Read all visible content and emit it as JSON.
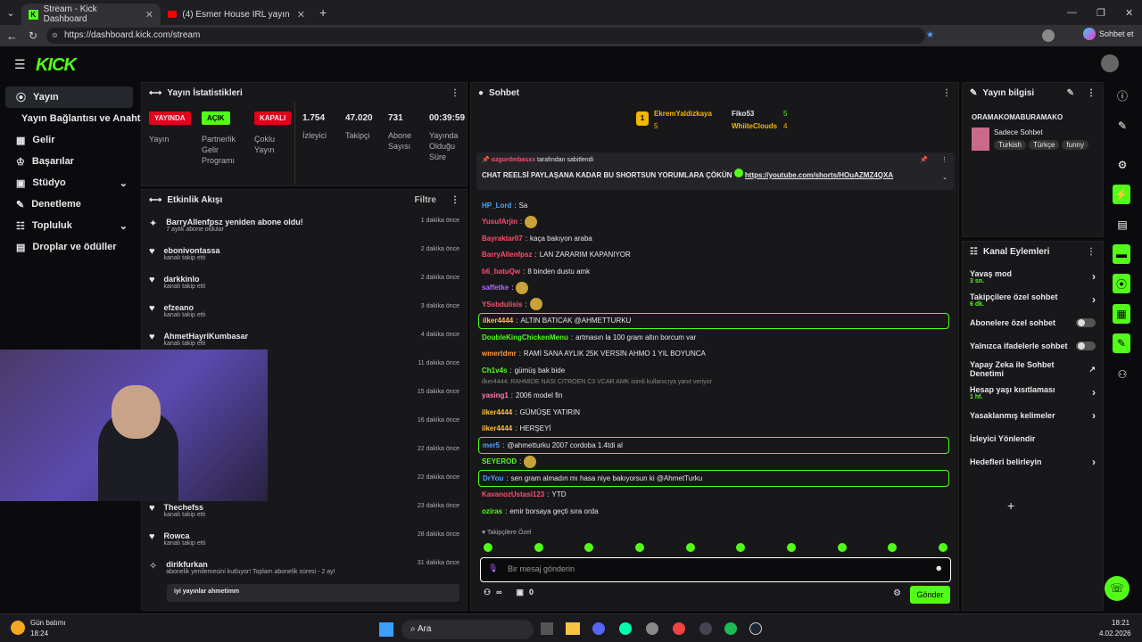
{
  "browser": {
    "tab1": "Stream - Kick Dashboard",
    "tab2": "(4) Esmer House IRL yayın derleme",
    "url": "https://dashboard.kick.com/stream",
    "profile": "Sohbet et"
  },
  "brand": {
    "logo": "KICK",
    "accent": "#53fc18"
  },
  "sidebar": {
    "items": [
      {
        "label": "Yayın"
      },
      {
        "label": "Yayın Bağlantısı ve Anahtarı"
      },
      {
        "label": "Gelir"
      },
      {
        "label": "Başarılar"
      },
      {
        "label": "Stüdyo"
      },
      {
        "label": "Denetleme"
      },
      {
        "label": "Topluluk"
      },
      {
        "label": "Droplar ve ödüller"
      }
    ]
  },
  "stats": {
    "title": "Yayın İstatistikleri",
    "live_badge": "YAYINDA",
    "live_label": "Yayın",
    "partner_badge": "AÇIK",
    "partner_label": "Partnerlik Gelir Programı",
    "multi_badge": "KAPALI",
    "multi_label": "Çoklu Yayın",
    "viewers": "1.754",
    "viewers_label": "İzleyici",
    "followers": "47.020",
    "followers_label": "Takipçi",
    "subs": "731",
    "subs_label": "Abone Sayısı",
    "duration": "00:39:59",
    "duration_label": "Yayında Olduğu Süre"
  },
  "activity": {
    "title": "Etkinlik Akışı",
    "filter": "Filtre",
    "items": [
      {
        "title": "BarryAllenfpsz yeniden abone oldu!",
        "sub": "7 aylık abone oldular",
        "time": "1 dakika önce"
      },
      {
        "title": "ebonivontassa",
        "sub": "kanalı takip etti",
        "time": "2 dakika önce"
      },
      {
        "title": "darkkinlo",
        "sub": "kanalı takip etti",
        "time": "2 dakika önce"
      },
      {
        "title": "efzeano",
        "sub": "kanalı takip etti",
        "time": "3 dakika önce"
      },
      {
        "title": "AhmetHayriKumbasar",
        "sub": "kanalı takip etti",
        "time": "4 dakika önce"
      },
      {
        "title": "",
        "sub": "",
        "time": "11 dakika önce"
      },
      {
        "title": "",
        "sub": "",
        "time": "15 dakika önce"
      },
      {
        "title": "",
        "sub": "",
        "time": "16 dakika önce"
      },
      {
        "title": "",
        "sub": "",
        "time": "22 dakika önce"
      },
      {
        "title": "",
        "sub": "",
        "time": "22 dakika önce"
      },
      {
        "title": "Thechefss",
        "sub": "kanalı takip etti",
        "time": "23 dakika önce"
      },
      {
        "title": "Rowca",
        "sub": "kanalı takip etti",
        "time": "28 dakika önce"
      },
      {
        "title": "dirikfurkan",
        "sub": "abonelik yenilemesini kutluyor! Toplam abonelik süresi - 2 ay!",
        "time": "31 dakika önce"
      }
    ],
    "last_msg": "iyi yayınlar ahmetimm"
  },
  "chat": {
    "title": "Sohbet",
    "top": [
      {
        "name": "EkremYaldizkaya",
        "count": "5"
      },
      {
        "name": "Fiko53",
        "count": "5"
      },
      {
        "name": "WhiiteClouds",
        "count": "4"
      }
    ],
    "pinned_by": "tarafından sabitlendi",
    "pinned_user": "ozgurdmbasxx",
    "pinned_text": "CHAT REELSİ PAYLAŞANA KADAR BU SHORTSUN YORUMLARA ÇÖKÜN",
    "pinned_link": "https://youtube.com/shorts/HOuAZMZ4QXA",
    "messages": [
      {
        "user": "HP_Lord",
        "color": "#4da3ff",
        "text": "Sa"
      },
      {
        "user": "YusufArjin",
        "color": "#ff4d6d",
        "text": ""
      },
      {
        "user": "Bayraktar07",
        "color": "#ff4d6d",
        "text": "kaça bakıyon araba"
      },
      {
        "user": "BarryAllenfpsz",
        "color": "#ff4d6d",
        "text": "LAN ZARARIM KAPANIYOR"
      },
      {
        "user": "b6_batuQw",
        "color": "#ff4d6d",
        "text": "8 binden dustu amk"
      },
      {
        "user": "saffetke",
        "color": "#b36bff",
        "text": ""
      },
      {
        "user": "YSsbdulisis",
        "color": "#ff4d6d",
        "text": ""
      },
      {
        "user": "ilker4444",
        "color": "#ffbf3f",
        "text": "ALTIN BATICAK @AHMETTURKU",
        "hl": true
      },
      {
        "user": "DoubleKingChickenMenu",
        "color": "#53fc18",
        "text": "artmasın la 100 gram altın borcum var"
      },
      {
        "user": "wmertdmr",
        "color": "#ff9a3f",
        "text": "RAMİ SANA AYLIK 25K VERSİN AHMO 1 YIL BOYUNCA"
      },
      {
        "user": "Ch1v4s",
        "color": "#53fc18",
        "text": "gümüş bak bide"
      },
      {
        "user": "yasing1",
        "color": "#ff7ab0",
        "text": "2006 model fin",
        "reply": "ilker4444: RAHMİDE NASI CİTROEN C3 VCAR AMK isimli kullanıcıya yanıt veriyor"
      },
      {
        "user": "ilker4444",
        "color": "#ffbf3f",
        "text": "GÜMÜŞE YATIRIN"
      },
      {
        "user": "ilker4444",
        "color": "#ffbf3f",
        "text": "HERŞEYİ"
      },
      {
        "user": "mer5",
        "color": "#4da3ff",
        "text": "@ahmetturku 2007 cordoba 1.4tdi al",
        "hl": true
      },
      {
        "user": "SEYEROD",
        "color": "#53fc18",
        "text": ""
      },
      {
        "user": "DrYou",
        "color": "#4da3ff",
        "text": "sen gram almadın mı hasa niye bakıyorsun ki @AhmetTurku",
        "hl": true
      },
      {
        "user": "KavanozUstasi123",
        "color": "#ff4d6d",
        "text": "YTD"
      },
      {
        "user": "oziras",
        "color": "#53fc18",
        "text": "emir borsaya geçti sıra orda"
      }
    ],
    "followers_only": "Takipçilere Özel",
    "placeholder": "Bir mesaj gönderin",
    "send": "Gönder",
    "counter": "0"
  },
  "info": {
    "title": "Yayın bilgisi",
    "stream_title": "ORAMAKOMABURAMAKO",
    "category": "Sadece Sohbet",
    "tags": [
      "Turkish",
      "Türkçe",
      "funny"
    ]
  },
  "actions": {
    "title": "Kanal Eylemleri",
    "items": [
      {
        "label": "Yavaş mod",
        "sub": "3 sn.",
        "type": "chev"
      },
      {
        "label": "Takipçilere özel sohbet",
        "sub": "6 dk.",
        "type": "chev"
      },
      {
        "label": "Abonelere özel sohbet",
        "sub": "",
        "type": "toggle"
      },
      {
        "label": "Yalnızca ifadelerle sohbet",
        "sub": "",
        "type": "toggle"
      },
      {
        "label": "Yapay Zeka ile Sohbet Denetimi",
        "sub": "",
        "type": "link"
      },
      {
        "label": "Hesap yaşı kısıtlaması",
        "sub": "1 hf.",
        "type": "chev"
      },
      {
        "label": "Yasaklanmış kelimeler",
        "sub": "",
        "type": "chev"
      },
      {
        "label": "İzleyici Yönlendir",
        "sub": "",
        "type": "none"
      },
      {
        "label": "Hedefleri belirleyin",
        "sub": "",
        "type": "chev"
      }
    ]
  },
  "taskbar": {
    "weather": "Gün batımı",
    "weather_time": "18:24",
    "search": "Ara",
    "clock": "18:21",
    "date": "4.02.2026"
  }
}
